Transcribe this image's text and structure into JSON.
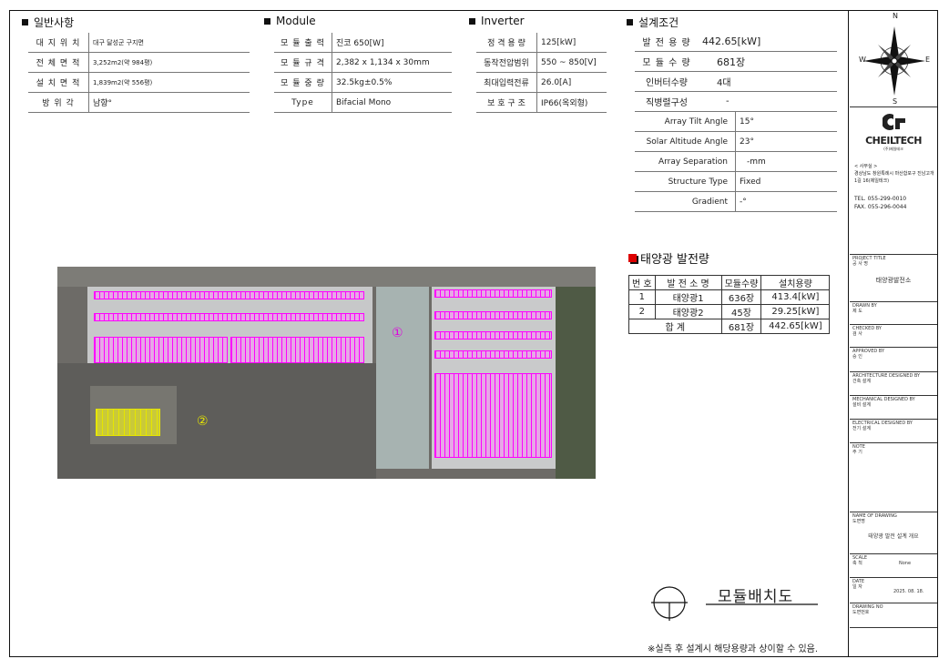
{
  "general": {
    "title": "일반사항",
    "rows": [
      {
        "k": "대 지 위 치",
        "v": "대구 달성군 구지면"
      },
      {
        "k": "전 체 면 적",
        "v": "3,252m2(약 984평)"
      },
      {
        "k": "설 치 면 적",
        "v": "1,839m2(약 556평)"
      },
      {
        "k": "방  위  각",
        "v": "남향°"
      }
    ]
  },
  "module": {
    "title": "Module",
    "rows": [
      {
        "k": "모 듈 출 력",
        "v": "진코 650[W]"
      },
      {
        "k": "모 듈 규 격",
        "v": "2,382 x 1,134 x 30mm"
      },
      {
        "k": "모 듈 중 량",
        "v": "32.5kg±0.5%"
      },
      {
        "k": "Type",
        "v": "Bifacial Mono"
      }
    ]
  },
  "inverter": {
    "title": "Inverter",
    "rows": [
      {
        "k": "정 격 용 량",
        "v": "125[kW]"
      },
      {
        "k": "동작전압범위",
        "v": "550 ~ 850[V]"
      },
      {
        "k": "최대입력전류",
        "v": "26.0[A]"
      },
      {
        "k": "보 호 구 조",
        "v": "IP66(옥외형)"
      }
    ]
  },
  "design": {
    "title": "설계조건",
    "rows": [
      {
        "k": "발 전 용 량",
        "v": "442.65[kW]"
      },
      {
        "k": "모 듈 수 량",
        "v": "681장"
      },
      {
        "k": "인버터수량",
        "v": "4대"
      },
      {
        "k": "직병렬구성",
        "v": "-"
      }
    ],
    "rows2": [
      {
        "k": "Array Tilt Angle",
        "v": "15°"
      },
      {
        "k": "Solar Altitude Angle",
        "v": "23°"
      },
      {
        "k": "Array Separation",
        "v": "-mm"
      },
      {
        "k": "Structure Type",
        "v": "Fixed"
      },
      {
        "k": "Gradient",
        "v": "-°"
      }
    ]
  },
  "capacity": {
    "title": "태양광 발전량",
    "headers": [
      "번 호",
      "발 전 소 명",
      "모듈수량",
      "설치용량"
    ],
    "rows": [
      [
        "1",
        "태양광1",
        "636장",
        "413.4[kW]"
      ],
      [
        "2",
        "태양광2",
        "45장",
        "29.25[kW]"
      ]
    ],
    "total": {
      "label": "합  계",
      "qty": "681장",
      "cap": "442.65[kW]"
    }
  },
  "aerial": {
    "marker1": "①",
    "marker2": "②"
  },
  "layout_title": "모듈배치도",
  "note": "※실측 후 설계시 해당용량과 상이할 수 있음.",
  "titleblock": {
    "compass": {
      "n": "N",
      "s": "S",
      "e": "E",
      "w": "W"
    },
    "logo": "CHEILTECH",
    "logo_sub": "(주)제일테크",
    "address_label": "< 사무실 >",
    "address": "경상남도 창원특례시 마산합포구 진남고개1길 16(제일테크)",
    "tel": "TEL. 055-299-0010",
    "fax": "FAX. 055-296-0044",
    "project_title_label": "PROJECT TITLE",
    "project_title_kr": "공 사 명",
    "project_title": "태양광발전소",
    "drawn_label": "DRAWN BY",
    "drawn_kr": "제  도",
    "checked_label": "CHECKED BY",
    "checked_kr": "검  사",
    "approved_label": "APPROVED BY",
    "approved_kr": "승  인",
    "arch_label": "ARCHITECTURE DESIGNED BY",
    "arch_kr": "건축 설계",
    "mech_label": "MECHANICAL DESIGNED BY",
    "mech_kr": "설비 설계",
    "elec_label": "ELECTRICAL DESIGNED BY",
    "elec_kr": "전기 설계",
    "note_label": "NOTE",
    "note_kr": "주  기",
    "drawing_name_label": "NAME OF DRAWING",
    "drawing_name_kr": "도면명",
    "drawing_name": "태양광 발전 설계 개요",
    "scale_label": "SCALE",
    "scale_kr": "축  척",
    "scale": "None",
    "date_label": "DATE",
    "date_kr": "일  자",
    "date": "2025. 08. 18.",
    "drawing_no_label": "DRAWING NO",
    "drawing_no_kr": "도면번호"
  }
}
